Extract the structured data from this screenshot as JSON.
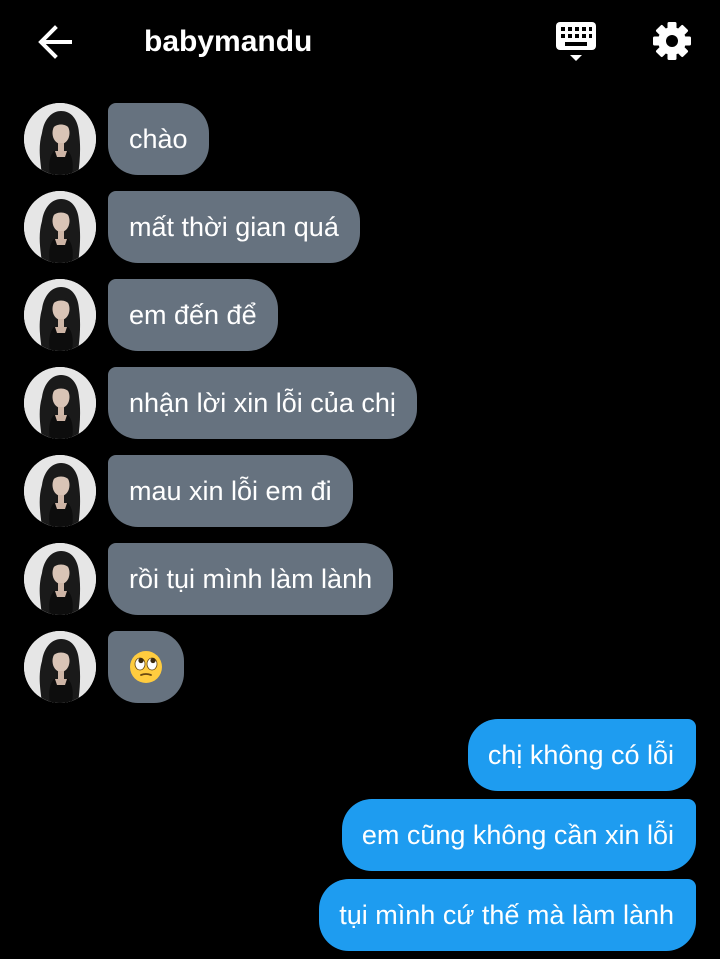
{
  "header": {
    "title": "babymandu",
    "back_icon": "arrow-left-icon",
    "keyboard_icon": "keyboard-icon",
    "settings_icon": "gear-icon"
  },
  "colors": {
    "background": "#000000",
    "incoming_bubble": "#66727f",
    "outgoing_bubble": "#1e9cf0",
    "text": "#ffffff"
  },
  "messages_in": [
    {
      "text": "chào"
    },
    {
      "text": "mất thời gian quá"
    },
    {
      "text": "em đến để"
    },
    {
      "text": "nhận lời xin lỗi của chị"
    },
    {
      "text": "mau xin lỗi em đi"
    },
    {
      "text": "rồi tụi mình làm lành"
    },
    {
      "emoji": "face-with-rolling-eyes-emoji"
    }
  ],
  "messages_out": [
    {
      "text": "chị không có lỗi"
    },
    {
      "text": "em cũng không cần xin lỗi"
    },
    {
      "text": "tụi mình cứ thế mà làm lành"
    }
  ]
}
